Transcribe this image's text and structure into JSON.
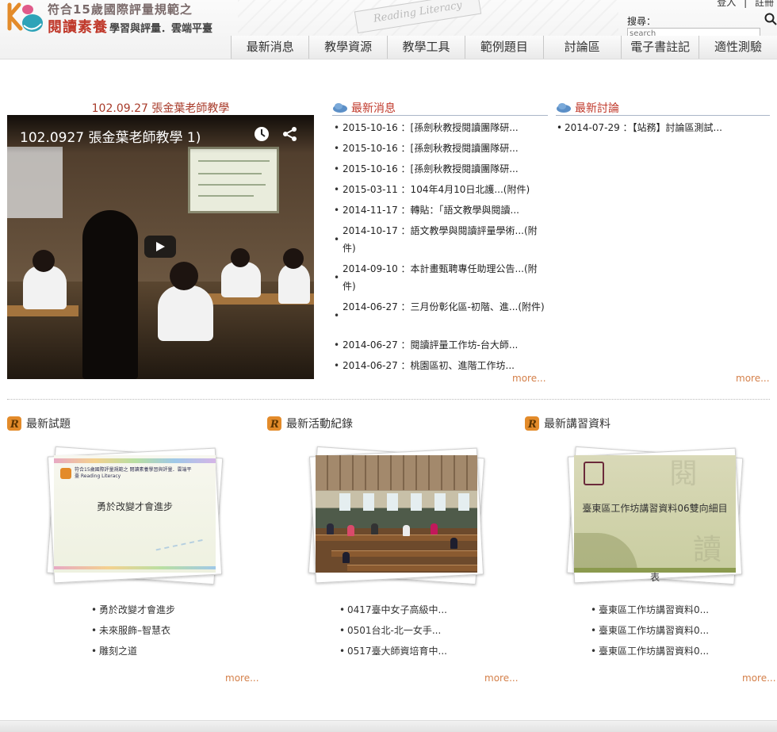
{
  "header": {
    "logo_line1": "符合15歲國際評量規範之",
    "logo_main": "閱讀素養",
    "logo_sub": "學習與評量．雲端平臺",
    "banner_text": "Reading Literacy",
    "login_label": "登入",
    "register_label": "註冊",
    "separator": "|",
    "search_label": "搜尋：",
    "search_placeholder": "search"
  },
  "nav": {
    "items": [
      "最新消息",
      "教學資源",
      "教學工具",
      "範例題目",
      "討論區",
      "電子書註記",
      "適性測驗"
    ]
  },
  "featured_video": {
    "title": "102.09.27 張金葉老師教學",
    "caption": "102.0927 張金葉老師教學 1)"
  },
  "news": {
    "heading": "最新消息",
    "items": [
      "2015-10-16 ：[孫劍秋教授閱讀團隊研...",
      "2015-10-16 ：[孫劍秋教授閱讀團隊研...",
      "2015-10-16 ：[孫劍秋教授閱讀團隊研...",
      "2015-03-11 ：104年4月10日北護...(附件)",
      "2014-11-17 ：轉貼：「語文教學與閱讀...",
      "2014-10-17 ：語文教學與閱讀評量學術...(附件)",
      "2014-09-10 ：本計畫甄聘專任助理公告...(附件)",
      "2014-06-27 ：三月份彰化區-初階、進...(附件)",
      "2014-06-27 ：閱讀評量工作坊-台大師...",
      "2014-06-27 ：桃園區初、進階工作坊..."
    ],
    "more_label": "more..."
  },
  "discussion": {
    "heading": "最新討論",
    "items": [
      "2014-07-29 ：【站務】討論區測試..."
    ],
    "more_label": "more..."
  },
  "questions": {
    "heading": "最新試題",
    "thumb_title": "勇於改變才會進步",
    "thumb_logo_text": "符合15歲國際評量規範之 閱讀素養學習與評量．雲端平臺 Reading Literacy",
    "items": [
      "勇於改變才會進步",
      "未來服飾–智慧衣",
      "雕刻之道"
    ],
    "more_label": "more..."
  },
  "activities": {
    "heading": "最新活動紀錄",
    "items": [
      "0417臺中女子高級中...",
      "0501台北-北一女手...",
      "0517臺大師資培育中..."
    ],
    "more_label": "more..."
  },
  "materials": {
    "heading": "最新講習資料",
    "thumb_title": "臺東區工作坊講習資料06雙向細目",
    "thumb_title_tail": "表",
    "items": [
      "臺東區工作坊講習資料0...",
      "臺東區工作坊講習資料0...",
      "臺東區工作坊講習資料0..."
    ],
    "more_label": "more..."
  },
  "icons": {
    "logo": "reading-logo-icon",
    "search": "search-icon",
    "clock": "clock-icon",
    "share": "share-icon",
    "play": "play-icon",
    "section_cloud": "cloud-icon",
    "section_r": "r-badge-icon"
  },
  "colors": {
    "accent_red": "#c0392b",
    "more_orange": "#d4804a",
    "r_badge": "#e38b2a"
  }
}
